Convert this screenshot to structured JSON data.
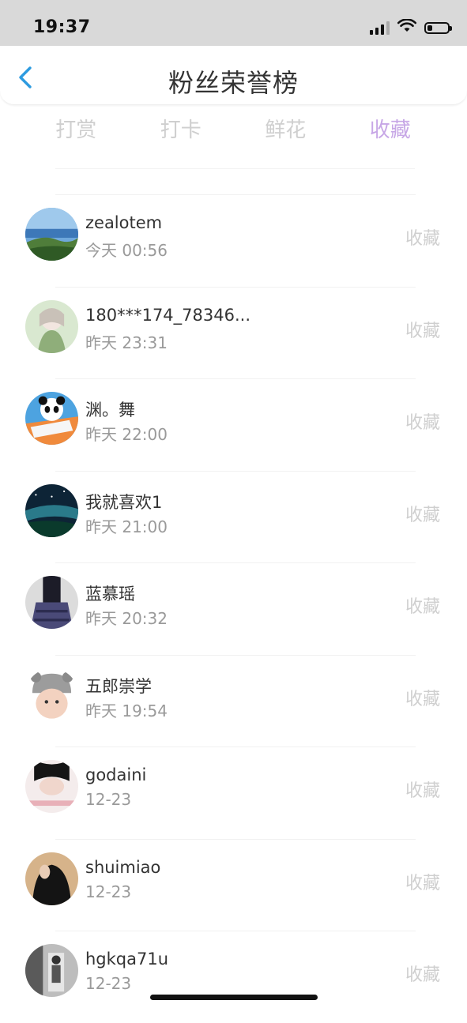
{
  "status_bar": {
    "time": "19:37"
  },
  "header": {
    "title": "粉丝荣誉榜"
  },
  "tabs": [
    {
      "label": "打赏",
      "active": false
    },
    {
      "label": "打卡",
      "active": false
    },
    {
      "label": "鲜花",
      "active": false
    },
    {
      "label": "收藏",
      "active": true
    }
  ],
  "colors": {
    "active_tab": "#c7a7e6",
    "inactive_tab": "#cfcfcf",
    "action_text": "#cfcfcf"
  },
  "fans": [
    {
      "name": "zealotem",
      "time": "今天 00:56",
      "action": "收藏"
    },
    {
      "name": "180***174_78346...",
      "time": "昨天 23:31",
      "action": "收藏"
    },
    {
      "name": "渊。舞",
      "time": "昨天 22:00",
      "action": "收藏"
    },
    {
      "name": "我就喜欢1",
      "time": "昨天 21:00",
      "action": "收藏"
    },
    {
      "name": "蓝慕瑶",
      "time": "昨天 20:32",
      "action": "收藏"
    },
    {
      "name": "五郎崇学",
      "time": "昨天 19:54",
      "action": "收藏"
    },
    {
      "name": "godaini",
      "time": "12-23",
      "action": "收藏"
    },
    {
      "name": "shuimiao",
      "time": "12-23",
      "action": "收藏"
    },
    {
      "name": "hgkqa71u",
      "time": "12-23",
      "action": "收藏"
    }
  ]
}
